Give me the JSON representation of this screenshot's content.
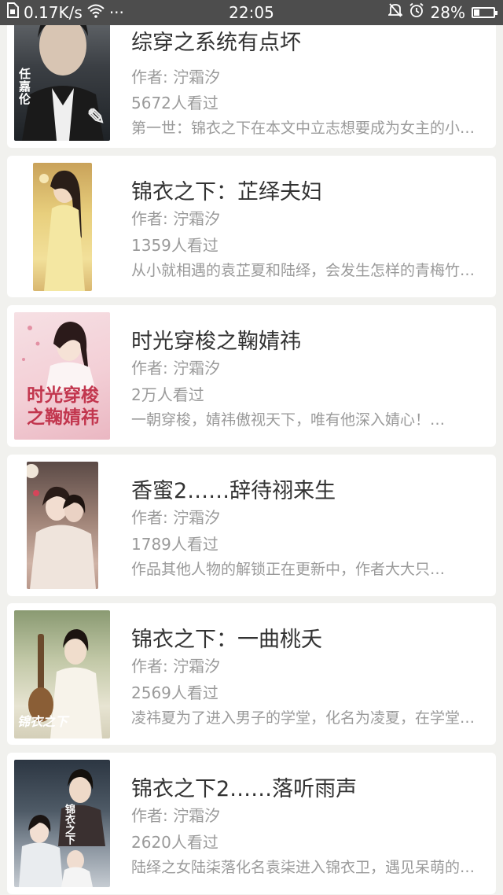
{
  "status_bar": {
    "speed": "0.17K/s",
    "dots": "···",
    "time": "22:05",
    "battery": "28%",
    "battery_level": 0.28
  },
  "books": [
    {
      "title": "综穿之系统有点坏",
      "author": "作者: 泞霜汐",
      "views": "5672人看过",
      "desc": "第一世：锦衣之下在本文中立志想要成为女主的小姐妹…",
      "cover_text": "任嘉伦"
    },
    {
      "title": "锦衣之下：芷绎夫妇",
      "author": "作者: 泞霜汐",
      "views": "1359人看过",
      "desc": "从小就相遇的袁芷夏和陆绎，会发生怎样的青梅竹马故事…",
      "cover_text": ""
    },
    {
      "title": "时光穿梭之鞠婧祎",
      "author": "作者: 泞霜汐",
      "views": "2万人看过",
      "desc": "一朝穿梭，婧祎傲视天下，唯有他深入婧心！…",
      "cover_text": "时光穿梭之鞠婧祎"
    },
    {
      "title": "香蜜2……辞待祤来生",
      "author": "作者: 泞霜汐",
      "views": "1789人看过",
      "desc": "作品其他人物的解锁正在更新中，作者大大只…",
      "cover_text": ""
    },
    {
      "title": "锦衣之下：一曲桃夭",
      "author": "作者: 泞霜汐",
      "views": "2569人看过",
      "desc": "凌祎夏为了进入男子的学堂，化名为凌夏，在学堂中…",
      "cover_text": "锦衣之下"
    },
    {
      "title": "锦衣之下2……落听雨声",
      "author": "作者: 泞霜汐",
      "views": "2620人看过",
      "desc": "陆绎之女陆柒落化名袁柒进入锦衣卫，遇见呆萌的小…",
      "cover_text": "锦衣之下"
    }
  ]
}
